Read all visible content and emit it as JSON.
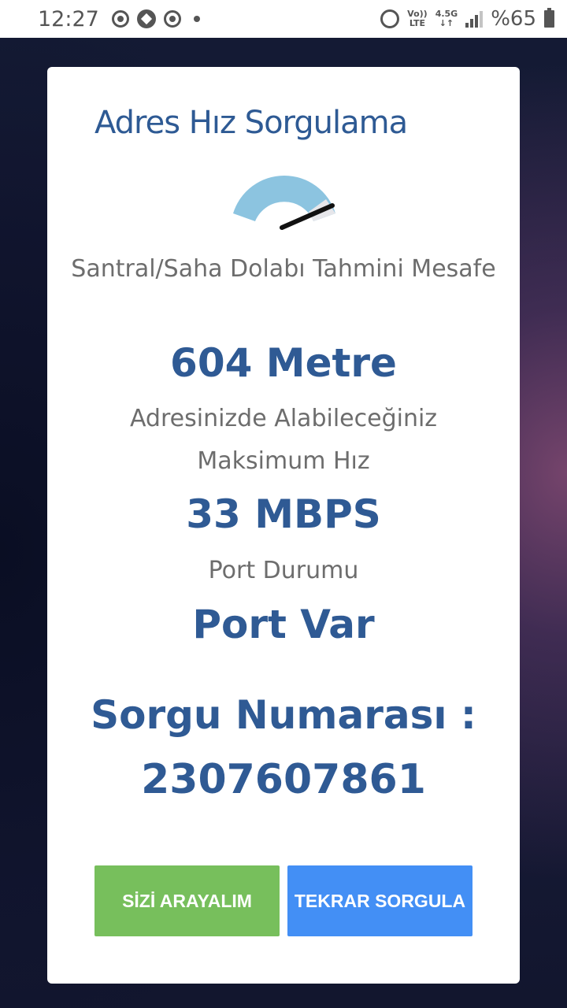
{
  "status_bar": {
    "time": "12:27",
    "volte_top": "Vo))",
    "volte_bottom": "LTE",
    "network_top": "4.5G",
    "network_bottom": "↓↑",
    "battery": "%65",
    "signal_level": 0.75,
    "battery_level": 0.65
  },
  "card": {
    "title": "Adres Hız Sorgulama",
    "gauge": {
      "icon": "speedometer-gauge-icon",
      "needle_level": 0.85,
      "arc_color": "#8cc4e0",
      "needle_color": "#111111"
    },
    "distance_label": "Santral/Saha Dolabı Tahmini Mesafe",
    "distance_value": "604 Metre",
    "speed_label": "Adresinizde Alabileceğiniz Maksimum Hız",
    "speed_value": "33 MBPS",
    "port_label": "Port Durumu",
    "port_value": "Port Var",
    "query_label": "Sorgu Numarası :",
    "query_number": "2307607861"
  },
  "buttons": {
    "call_label": "SİZİ ARAYALIM",
    "retry_label": "TEKRAR SORGULA"
  },
  "colors": {
    "title": "#2e5a94",
    "value": "#2f5a94",
    "label": "#6d6d6d",
    "call_button": "#77bf5c",
    "retry_button": "#438ff5"
  }
}
